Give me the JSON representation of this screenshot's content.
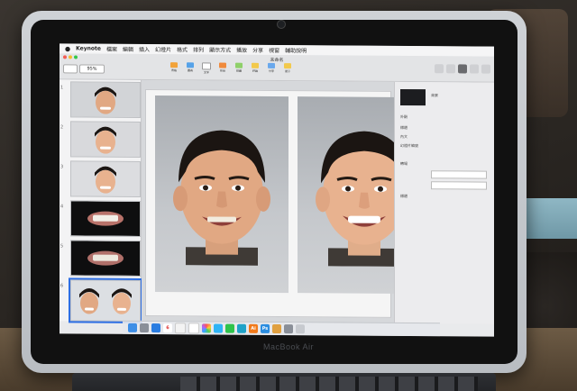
{
  "menubar": {
    "apple_icon": "",
    "items": [
      "Keynote",
      "檔案",
      "編輯",
      "插入",
      "幻燈片",
      "格式",
      "排列",
      "顯示方式",
      "播放",
      "分享",
      "視窗",
      "輔助說明"
    ]
  },
  "toolbar": {
    "document_title": "未命名",
    "zoom_value": "95%",
    "tools": [
      {
        "label": "表格",
        "icon": "table-icon",
        "color": "#f2a33a"
      },
      {
        "label": "圖表",
        "icon": "chart-icon",
        "color": "#56a2e8"
      },
      {
        "label": "文字",
        "icon": "text-icon",
        "color": "#e9eaec"
      },
      {
        "label": "形狀",
        "icon": "shape-icon",
        "color": "#f08a3c"
      },
      {
        "label": "媒體",
        "icon": "media-icon",
        "color": "#8fd06a"
      },
      {
        "label": "評論",
        "icon": "comment-icon",
        "color": "#f2c94c"
      },
      {
        "label": "分享",
        "icon": "share-icon",
        "color": "#6aa8ec"
      },
      {
        "label": "提示",
        "icon": "tips-icon",
        "color": "#f2c94c"
      },
      {
        "label": "",
        "icon": "play-icon",
        "color": "#333333"
      }
    ]
  },
  "slides": [
    {
      "number": "1",
      "kind": "face"
    },
    {
      "number": "2",
      "kind": "face"
    },
    {
      "number": "3",
      "kind": "face"
    },
    {
      "number": "4",
      "kind": "teeth"
    },
    {
      "number": "5",
      "kind": "teeth"
    },
    {
      "number": "6",
      "kind": "pair",
      "selected": true
    }
  ],
  "inspector": {
    "labels": [
      "背景",
      "外觀",
      "標題",
      "內文",
      "幻燈片編號",
      "轉場",
      "標題"
    ]
  },
  "laptop": {
    "model": "MacBook Air"
  },
  "dock": {
    "apps": [
      "finder-icon",
      "launchpad-icon",
      "safari-icon",
      "calendar-icon",
      "notes-icon",
      "reminders-icon",
      "photos-icon",
      "messages-icon",
      "line-icon",
      "kakao-icon",
      "illustrator-icon",
      "photoshop-icon",
      "keynote-icon",
      "settings-icon",
      "trash-icon"
    ],
    "calendar_day": "6",
    "illustrator_text": "Ai",
    "photoshop_text": "Ps"
  },
  "colors": {
    "accent": "#2e6fe4",
    "photo_bg": "#c5c8cc",
    "skin": "#e8b28f"
  }
}
